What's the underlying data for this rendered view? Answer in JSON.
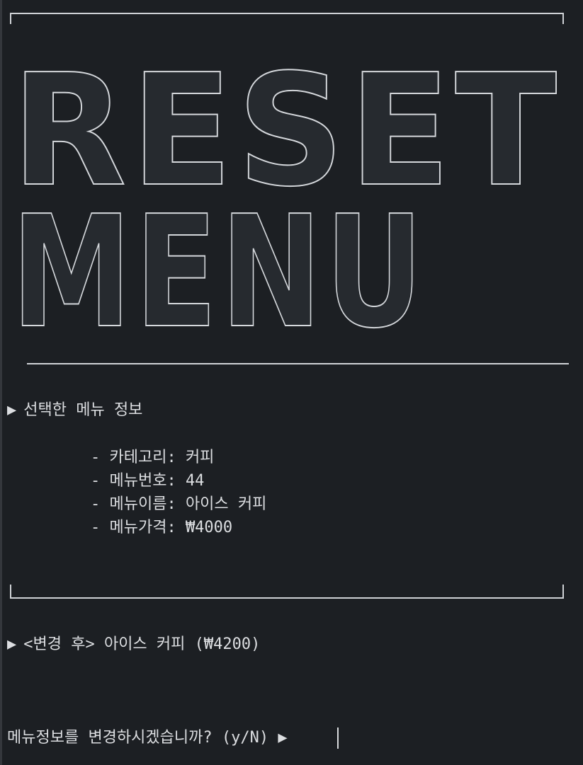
{
  "banner": {
    "line1": "RESET",
    "line2": "MENU"
  },
  "section": {
    "arrow": "▶",
    "title": "선택한 메뉴 정보"
  },
  "info": {
    "category": "- 카테고리: 커피",
    "number": "- 메뉴번호: 44",
    "name": "- 메뉴이름: 아이스 커피",
    "price": "- 메뉴가격: ₩4000"
  },
  "change": {
    "arrow": "▶",
    "text": "<변경 후> 아이스 커피 (₩4200)"
  },
  "prompt": {
    "text": "메뉴정보를 변경하시겠습니까? (y/N) ▶"
  }
}
